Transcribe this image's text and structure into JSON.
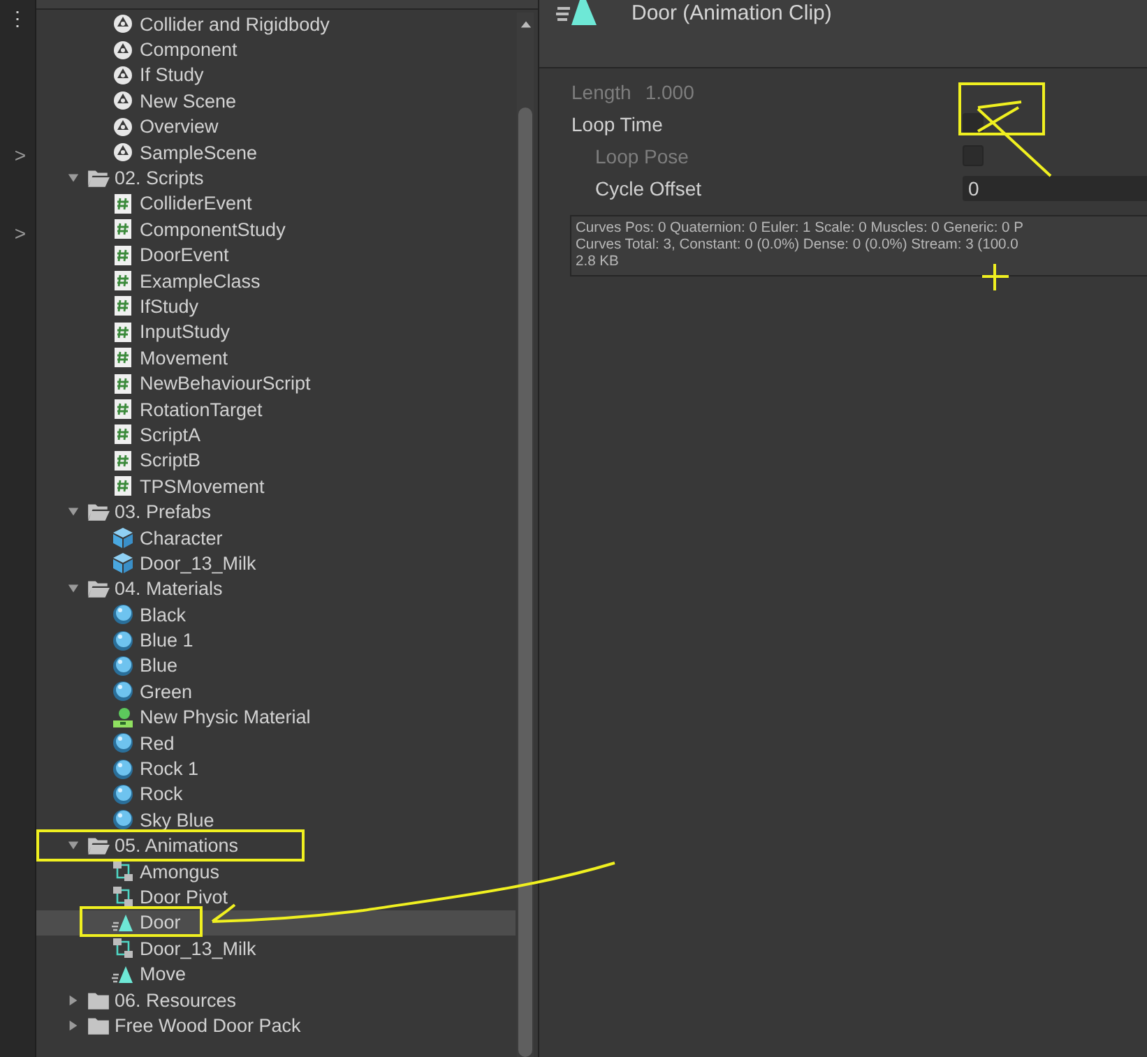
{
  "side_strip": {
    "menu": "⋮",
    "chevrons": [
      ">",
      ">"
    ]
  },
  "tree": [
    {
      "children": [
        {
          "name": "Collider and Rigidbody",
          "kind": "scene",
          "selected": false
        },
        {
          "name": "Component",
          "kind": "scene",
          "selected": false
        },
        {
          "name": "If Study",
          "kind": "scene",
          "selected": false
        },
        {
          "name": "New Scene",
          "kind": "scene",
          "selected": false
        },
        {
          "name": "Overview",
          "kind": "scene",
          "selected": false
        },
        {
          "name": "SampleScene",
          "kind": "scene",
          "selected": false
        }
      ]
    },
    {
      "name": "02. Scripts",
      "kind": "folder",
      "expanded": true,
      "selected": false,
      "children": [
        {
          "name": "ColliderEvent",
          "kind": "script",
          "selected": false
        },
        {
          "name": "ComponentStudy",
          "kind": "script",
          "selected": false
        },
        {
          "name": "DoorEvent",
          "kind": "script",
          "selected": false
        },
        {
          "name": "ExampleClass",
          "kind": "script",
          "selected": false
        },
        {
          "name": "IfStudy",
          "kind": "script",
          "selected": false
        },
        {
          "name": "InputStudy",
          "kind": "script",
          "selected": false
        },
        {
          "name": "Movement",
          "kind": "script",
          "selected": false
        },
        {
          "name": "NewBehaviourScript",
          "kind": "script",
          "selected": false
        },
        {
          "name": "RotationTarget",
          "kind": "script",
          "selected": false
        },
        {
          "name": "ScriptA",
          "kind": "script",
          "selected": false
        },
        {
          "name": "ScriptB",
          "kind": "script",
          "selected": false
        },
        {
          "name": "TPSMovement",
          "kind": "script",
          "selected": false
        }
      ]
    },
    {
      "name": "03. Prefabs",
      "kind": "folder",
      "expanded": true,
      "selected": false,
      "children": [
        {
          "name": "Character",
          "kind": "prefab",
          "selected": false
        },
        {
          "name": "Door_13_Milk",
          "kind": "prefab",
          "selected": false
        }
      ]
    },
    {
      "name": "04. Materials",
      "kind": "folder",
      "expanded": true,
      "selected": false,
      "children": [
        {
          "name": "Black",
          "kind": "material",
          "selected": false
        },
        {
          "name": "Blue 1",
          "kind": "material",
          "selected": false
        },
        {
          "name": "Blue",
          "kind": "material",
          "selected": false
        },
        {
          "name": "Green",
          "kind": "material",
          "selected": false
        },
        {
          "name": "New Physic Material",
          "kind": "physic",
          "selected": false
        },
        {
          "name": "Red",
          "kind": "material",
          "selected": false
        },
        {
          "name": "Rock 1",
          "kind": "material",
          "selected": false
        },
        {
          "name": "Rock",
          "kind": "material",
          "selected": false
        },
        {
          "name": "Sky Blue",
          "kind": "material",
          "selected": false
        }
      ]
    },
    {
      "name": "05. Animations",
      "kind": "folder",
      "expanded": true,
      "selected": false,
      "children": [
        {
          "name": "Amongus",
          "kind": "animator",
          "selected": false
        },
        {
          "name": "Door Pivot",
          "kind": "animator",
          "selected": false
        },
        {
          "name": "Door",
          "kind": "clip",
          "selected": true
        },
        {
          "name": "Door_13_Milk",
          "kind": "animator",
          "selected": false
        },
        {
          "name": "Move",
          "kind": "clip",
          "selected": false
        }
      ]
    },
    {
      "name": "06. Resources",
      "kind": "folder",
      "expanded": false,
      "selected": false
    },
    {
      "name": "Free Wood Door Pack",
      "kind": "folder",
      "expanded": false,
      "selected": false
    }
  ],
  "inspector": {
    "title": "Door (Animation Clip)",
    "fields": [
      {
        "kind": "readonly",
        "label": "Length",
        "value": "1.000",
        "disabled": true
      },
      {
        "kind": "checkbox",
        "label": "Loop Time",
        "checked": false,
        "disabled": false
      },
      {
        "kind": "checkbox",
        "label": "Loop Pose",
        "checked": false,
        "disabled": true
      },
      {
        "kind": "number",
        "label": "Cycle Offset",
        "value": "0",
        "disabled": false
      }
    ],
    "info_lines": [
      "Curves Pos: 0 Quaternion: 0 Euler: 1 Scale: 0 Muscles: 0 Generic: 0 P",
      "Curves Total: 3, Constant: 0 (0.0%) Dense: 0 (0.0%) Stream: 3 (100.0",
      "2.8 KB"
    ]
  }
}
